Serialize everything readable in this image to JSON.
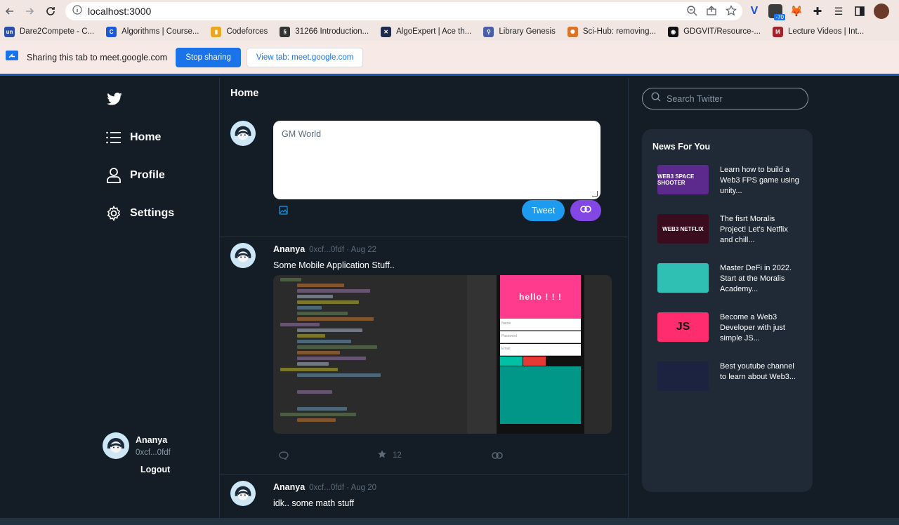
{
  "browser": {
    "url": "localhost:3000",
    "ext_badge": "-70",
    "bookmarks": [
      {
        "label": "Dare2Compete - C...",
        "color": "#2c4ea3",
        "glyph": "un"
      },
      {
        "label": "Algorithms | Course...",
        "color": "#1a5ad8",
        "glyph": "C"
      },
      {
        "label": "Codeforces",
        "color": "#e8a71e",
        "glyph": "▮"
      },
      {
        "label": "31266 Introduction...",
        "color": "#333333",
        "glyph": "§"
      },
      {
        "label": "AlgoExpert | Ace th...",
        "color": "#1e2b4a",
        "glyph": "✕"
      },
      {
        "label": "Library Genesis",
        "color": "#4a5fa8",
        "glyph": "⚲"
      },
      {
        "label": "Sci-Hub: removing...",
        "color": "#d9742b",
        "glyph": "✺"
      },
      {
        "label": "GDGVIT/Resource-...",
        "color": "#111111",
        "glyph": "◉"
      },
      {
        "label": "Lecture Videos | Int...",
        "color": "#a3232b",
        "glyph": "M"
      }
    ]
  },
  "share_bar": {
    "text": "Sharing this tab to meet.google.com",
    "stop_label": "Stop sharing",
    "view_label": "View tab: meet.google.com"
  },
  "nav": {
    "items": [
      {
        "label": "Home",
        "icon": "list-icon"
      },
      {
        "label": "Profile",
        "icon": "person-icon"
      },
      {
        "label": "Settings",
        "icon": "gear-icon"
      }
    ],
    "user": {
      "name": "Ananya",
      "address": "0xcf...0fdf",
      "logout": "Logout"
    }
  },
  "feed": {
    "title": "Home",
    "compose": {
      "text": "GM World",
      "tweet_label": "Tweet"
    },
    "posts": [
      {
        "name": "Ananya",
        "meta": "0xcf...0fdf · Aug 22",
        "text": "Some Mobile Application Stuff..",
        "likes": "12",
        "image_text": "hello ! ! !"
      },
      {
        "name": "Ananya",
        "meta": "0xcf...0fdf · Aug 20",
        "text": "idk.. some math stuff"
      }
    ]
  },
  "right": {
    "search_placeholder": "Search Twitter",
    "news_title": "News For You",
    "news": [
      {
        "text": "Learn how to build a Web3 FPS game using unity...",
        "thumb": "WEB3 SPACE SHOOTER",
        "bg": "#5b2a8c"
      },
      {
        "text": "The fisrt Moralis Project! Let's Netflix and chill...",
        "thumb": "WEB3 NETFLIX",
        "bg": "#3a0d1e"
      },
      {
        "text": "Master DeFi in 2022. Start at the Moralis Academy...",
        "thumb": "",
        "bg": "#2fbfb3"
      },
      {
        "text": "Become a Web3 Developer with just simple JS...",
        "thumb": "JS",
        "bg": "#ff2d6f"
      },
      {
        "text": "Best youtube channel to learn about Web3...",
        "thumb": "",
        "bg": "#1b2341"
      }
    ]
  }
}
